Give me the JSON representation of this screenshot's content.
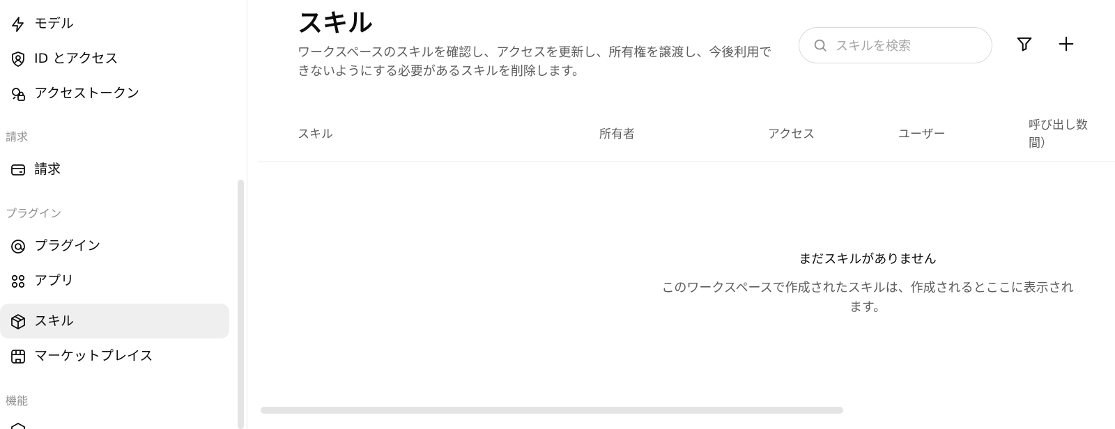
{
  "sidebar": {
    "items_top": [
      {
        "label": "モデル",
        "icon": "lightning-icon"
      },
      {
        "label": "ID とアクセス",
        "icon": "user-shield-icon"
      },
      {
        "label": "アクセストークン",
        "icon": "key-lock-icon"
      }
    ],
    "section_billing": "請求",
    "billing_item": {
      "label": "請求",
      "icon": "credit-card-icon"
    },
    "section_plugins": "プラグイン",
    "plugin_items": [
      {
        "label": "プラグイン",
        "icon": "plugin-icon"
      },
      {
        "label": "アプリ",
        "icon": "apps-grid-icon"
      },
      {
        "label": "スキル",
        "icon": "cube-icon",
        "active": true
      },
      {
        "label": "マーケットプレイス",
        "icon": "storefront-icon"
      }
    ],
    "section_features": "機能"
  },
  "main": {
    "title": "スキル",
    "description": "ワークスペースのスキルを確認し、アクセスを更新し、所有権を譲渡し、今後利用できないようにする必要があるスキルを削除します。",
    "search": {
      "placeholder": "スキルを検索",
      "value": ""
    },
    "table": {
      "columns": [
        "スキル",
        "所有者",
        "アクセス",
        "ユーザー",
        "呼び出し数間）"
      ]
    },
    "empty_state": {
      "title": "まだスキルがありません",
      "description": "このワークスペースで作成されたスキルは、作成されるとここに表示されます。"
    }
  },
  "colors": {
    "active_bg": "#efefef",
    "text_primary": "#0d0d0d",
    "text_secondary": "#5d5d5d",
    "section_header": "#8f8f8f"
  }
}
